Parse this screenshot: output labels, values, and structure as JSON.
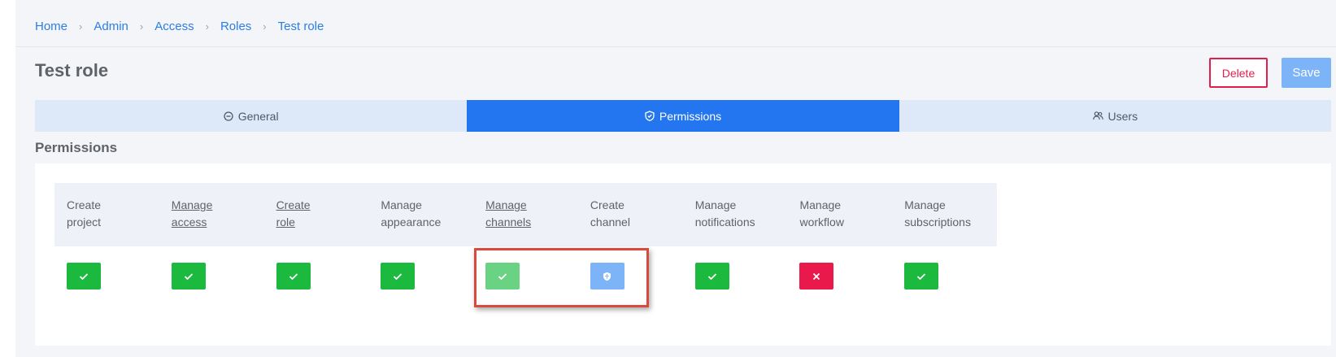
{
  "breadcrumb": [
    "Home",
    "Admin",
    "Access",
    "Roles",
    "Test role"
  ],
  "page_title": "Test role",
  "actions": {
    "delete_label": "Delete",
    "save_label": "Save"
  },
  "tabs": [
    {
      "label": "General",
      "icon": "minus-circle-icon",
      "active": false
    },
    {
      "label": "Permissions",
      "icon": "shield-check-icon",
      "active": true
    },
    {
      "label": "Users",
      "icon": "users-icon",
      "active": false
    }
  ],
  "section_title": "Permissions",
  "permissions": [
    {
      "line1": "Create",
      "line2": "project",
      "linked": false,
      "state": "granted"
    },
    {
      "line1": "Manage",
      "line2": "access",
      "linked": true,
      "state": "granted"
    },
    {
      "line1": "Create",
      "line2": "role",
      "linked": true,
      "state": "granted"
    },
    {
      "line1": "Manage",
      "line2": "appearance",
      "linked": false,
      "state": "granted"
    },
    {
      "line1": "Manage",
      "line2": "channels",
      "linked": true,
      "state": "granted-light"
    },
    {
      "line1": "Create",
      "line2": "channel",
      "linked": false,
      "state": "shield"
    },
    {
      "line1": "Manage",
      "line2": "notifications",
      "linked": false,
      "state": "granted"
    },
    {
      "line1": "Manage",
      "line2": "workflow",
      "linked": false,
      "state": "denied"
    },
    {
      "line1": "Manage",
      "line2": "subscriptions",
      "linked": false,
      "state": "granted"
    }
  ],
  "colors": {
    "accent": "#2476f0",
    "granted": "#1bba3e",
    "denied": "#e9194b",
    "highlight": "#d94a3d"
  }
}
